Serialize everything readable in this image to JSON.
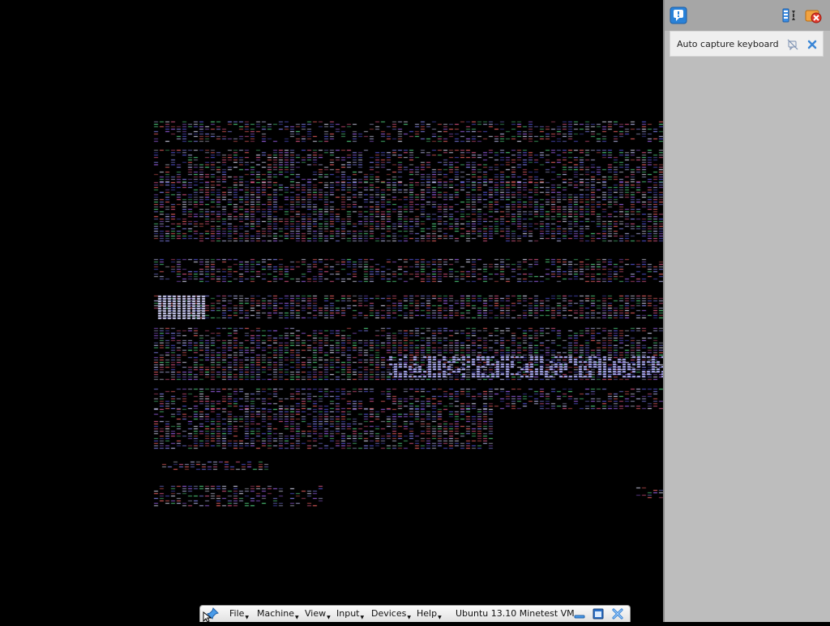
{
  "notification_panel": {
    "toolbar": {
      "notify_icon": "notification-icon",
      "collapse_icon": "collapse-all-icon",
      "close_all_icon": "close-all-icon"
    },
    "items": [
      {
        "text": "Auto capture keyboard ...",
        "dont_show_icon": "dont-show-again-icon",
        "close_icon": "close-icon"
      }
    ]
  },
  "mini_toolbar": {
    "pin_icon": "pin-icon",
    "menus": [
      {
        "label": "File"
      },
      {
        "label": "Machine"
      },
      {
        "label": "View"
      },
      {
        "label": "Input"
      },
      {
        "label": "Devices"
      },
      {
        "label": "Help"
      }
    ],
    "vm_title": "Ubuntu 13.10 Minetest VM",
    "buttons": {
      "minimize_icon": "minimize-icon",
      "restore_icon": "restore-icon",
      "close_icon": "close-icon"
    }
  },
  "colors": {
    "screen_background": "#000000",
    "panel_background": "#bdbdbd",
    "notification_item": "#efefef",
    "accent_blue": "#2a82d8",
    "close_red": "#d8342a"
  }
}
